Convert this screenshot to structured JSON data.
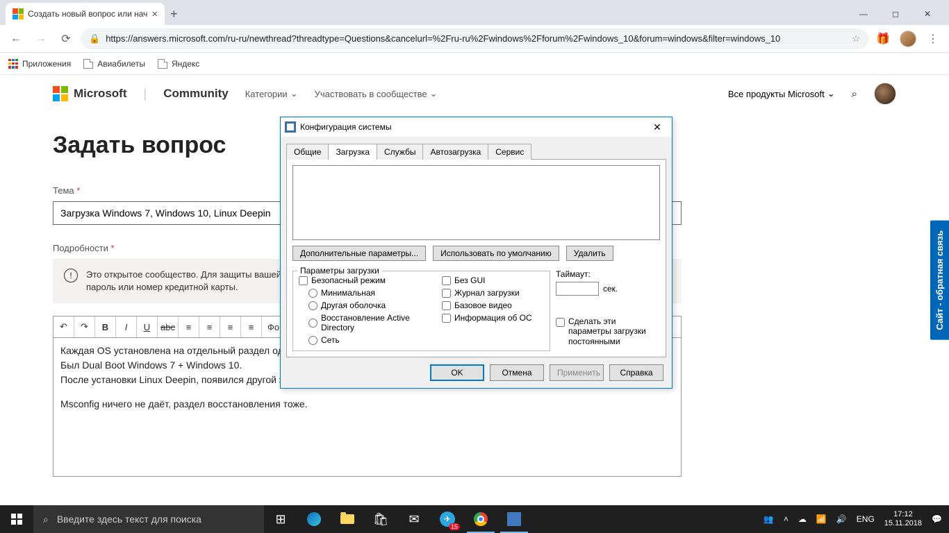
{
  "browser": {
    "tab_title": "Создать новый вопрос или нач",
    "url": "https://answers.microsoft.com/ru-ru/newthread?threadtype=Questions&cancelurl=%2Fru-ru%2Fwindows%2Fforum%2Fwindows_10&forum=windows&filter=windows_10",
    "bookmarks": {
      "apps": "Приложения",
      "b1": "Авиабилеты",
      "b2": "Яндекс"
    }
  },
  "header": {
    "brand": "Microsoft",
    "community": "Community",
    "nav1": "Категории",
    "nav2": "Участвовать в сообществе",
    "all_products": "Все продукты Microsoft"
  },
  "page": {
    "title": "Задать вопрос",
    "theme_label": "Тема",
    "theme_value": "Загрузка Windows 7, Windows 10, Linux Deepin",
    "details_label": "Подробности",
    "notice": "Это открытое сообщество. Для защиты вашей конфиденциальной информации не указывайте свой номер телефона, ключ продукта, пароль или номер кредитной карты.",
    "toolbar_format": "Форм",
    "content_l1": "Каждая OS установлена на отдельный раздел одного накопителя.",
    "content_l2": "Был Dual Boot Windows 7 + Windows 10.",
    "content_l3": "После установки Linux Deepin, появился другой загрузчик в котором можно загрузить только Windows 10.",
    "content_l4": "Msconfig ничего не даёт, раздел восстановления тоже.",
    "feedback": "Сайт - обратная связь"
  },
  "dialog": {
    "title": "Конфигурация системы",
    "tabs": [
      "Общие",
      "Загрузка",
      "Службы",
      "Автозагрузка",
      "Сервис"
    ],
    "btn_advanced": "Дополнительные параметры...",
    "btn_default": "Использовать по умолчанию",
    "btn_delete": "Удалить",
    "fieldset_params": "Параметры загрузки",
    "chk_safe": "Безопасный режим",
    "rdo_min": "Минимальная",
    "rdo_shell": "Другая оболочка",
    "rdo_ad": "Восстановление Active Directory",
    "rdo_net": "Сеть",
    "chk_nogui": "Без GUI",
    "chk_bootlog": "Журнал загрузки",
    "chk_basevid": "Базовое видео",
    "chk_osinfo": "Информация  об ОС",
    "timeout_label": "Таймаут:",
    "timeout_unit": "сек.",
    "chk_permanent": "Сделать эти параметры загрузки постоянными",
    "btn_ok": "OK",
    "btn_cancel": "Отмена",
    "btn_apply": "Применить",
    "btn_help": "Справка"
  },
  "taskbar": {
    "search_placeholder": "Введите здесь текст для поиска",
    "lang": "ENG",
    "time": "17:12",
    "date": "15.11.2018",
    "badge": "15"
  }
}
